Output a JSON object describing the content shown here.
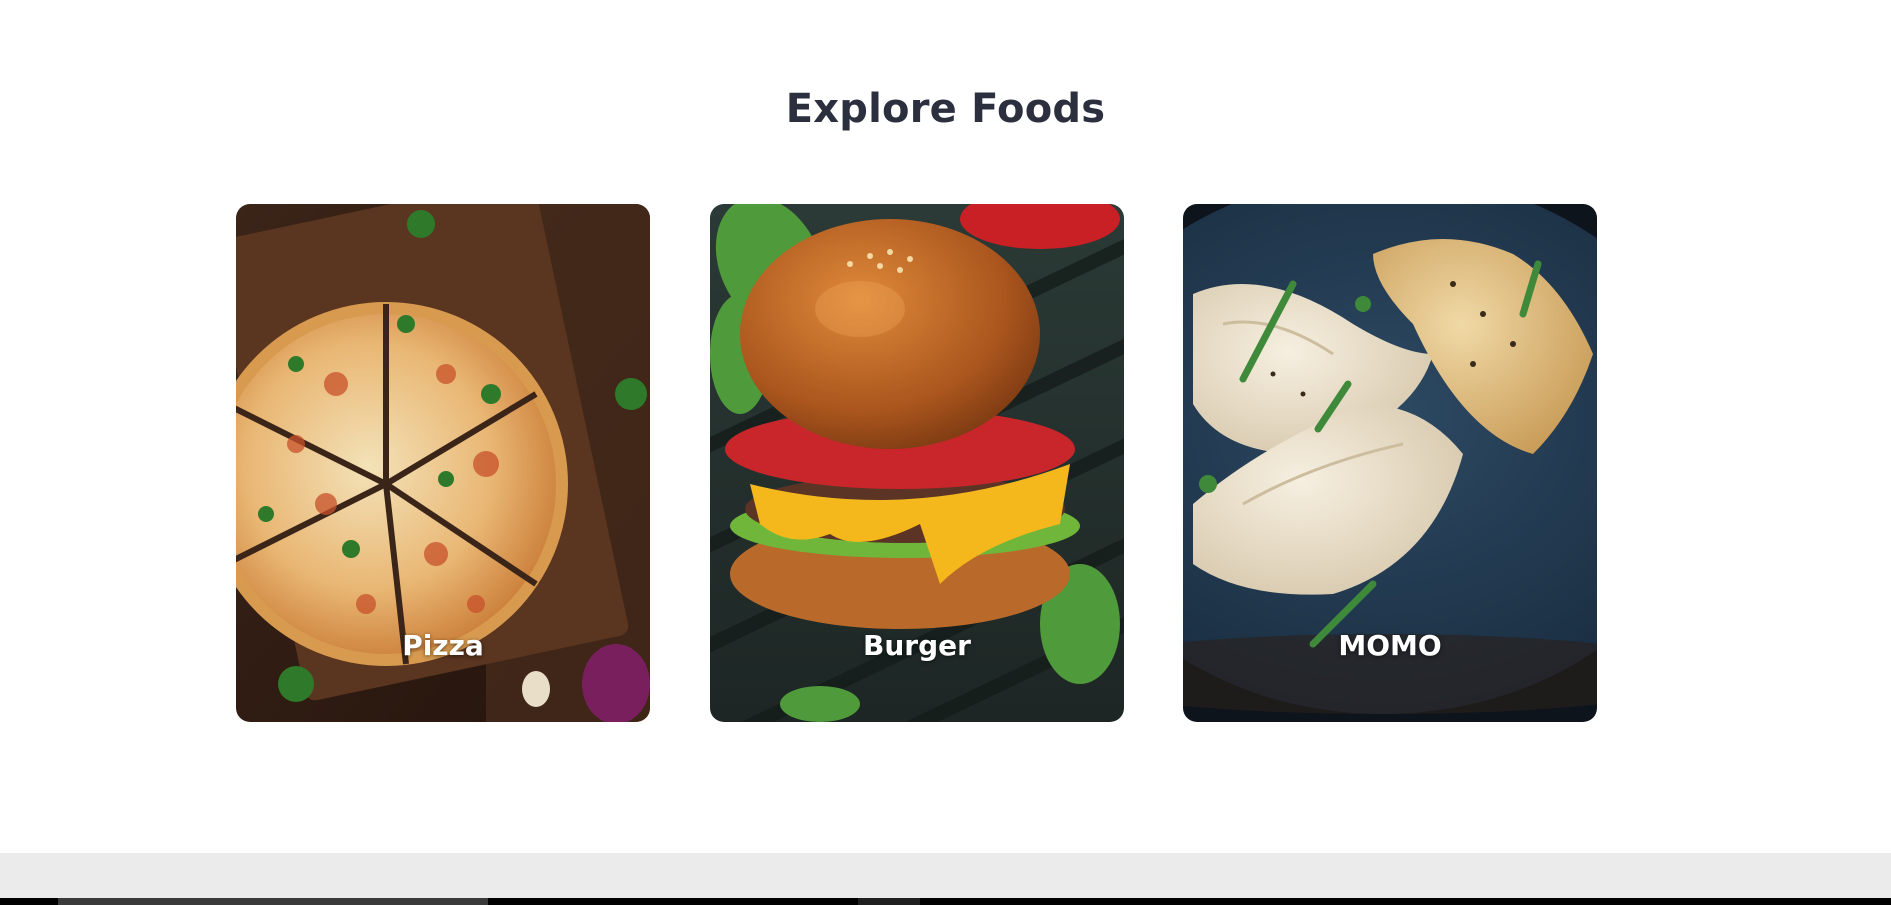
{
  "section": {
    "title": "Explore Foods"
  },
  "foods": [
    {
      "label": "Pizza",
      "icon": "pizza-image"
    },
    {
      "label": "Burger",
      "icon": "burger-image"
    },
    {
      "label": "MOMO",
      "icon": "momo-image"
    }
  ],
  "colors": {
    "title": "#2b2f3e",
    "label": "#ffffff",
    "footer_band": "#ebebeb"
  }
}
